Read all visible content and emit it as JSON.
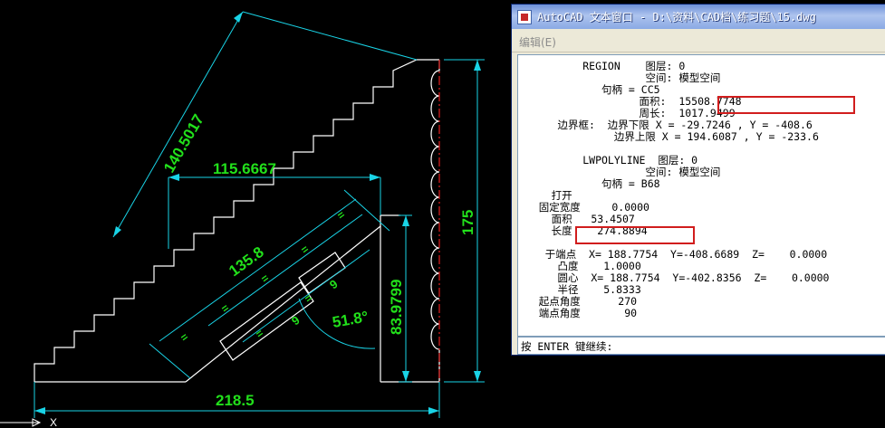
{
  "drawing": {
    "dimensions": {
      "left_diag": "140.5017",
      "top_width": "115.6667",
      "inner_diag": "135.8",
      "mid_height": "83.9799",
      "right_height": "175",
      "bottom_width": "218.5",
      "angle": "51.8°",
      "small_a": "9",
      "small_b": "9"
    },
    "ucs_label": "X",
    "colors": {
      "background": "#000000",
      "geometry": "#ffffff",
      "dimension": "#19d3e6",
      "dimension_text": "#22e01b",
      "centerline": "#e11d1d"
    }
  },
  "text_window": {
    "title": "AutoCAD 文本窗口 - D:\\资料\\CAD档\\练习题\\15.dwg",
    "menu_edit": "编辑(E)",
    "lines": [
      "          REGION    图层: 0",
      "                    空间: 模型空间",
      "             句柄 = CC5",
      "                   面积:  15508.7748",
      "                   周长:  1017.9499",
      "      边界框:  边界下限 X = -29.7246 , Y = -408.6",
      "               边界上限 X = 194.6087 , Y = -233.6",
      "",
      "          LWPOLYLINE  图层: 0",
      "                    空间: 模型空间",
      "             句柄 = B68",
      "     打开",
      "   固定宽度     0.0000",
      "     面积   53.4507",
      "     长度    274.8894",
      "",
      "    于端点  X= 188.7754  Y=-408.6689  Z=    0.0000",
      "      凸度    1.0000",
      "      圆心  X= 188.7754  Y=-402.8356  Z=    0.0000",
      "      半径    5.8333",
      "   起点角度      270",
      "   端点角度       90"
    ],
    "command_prompt": "按 ENTER 键继续:",
    "highlight_color": "#d11d1d"
  }
}
